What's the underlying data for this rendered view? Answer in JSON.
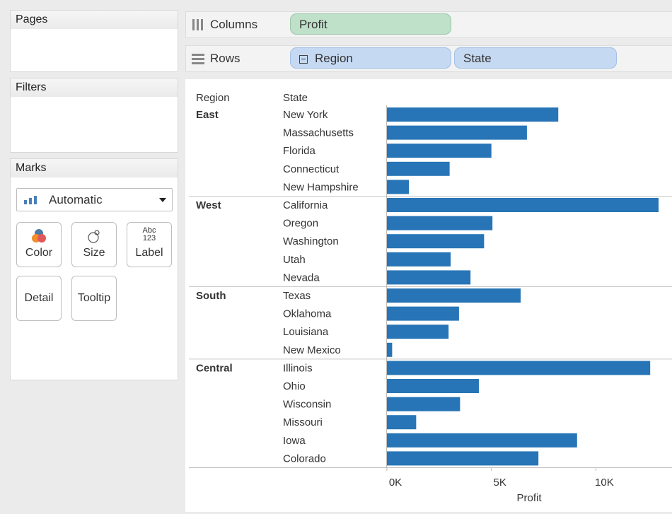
{
  "panels": {
    "pages": "Pages",
    "filters": "Filters",
    "marks": "Marks"
  },
  "marks_card": {
    "mark_type": "Automatic",
    "buttons": {
      "color": "Color",
      "size": "Size",
      "label": "Label",
      "label_icon_top": "Abc",
      "label_icon_bottom": "123",
      "detail": "Detail",
      "tooltip": "Tooltip"
    }
  },
  "shelves": {
    "columns": {
      "label": "Columns",
      "pills": [
        "Profit"
      ]
    },
    "rows": {
      "label": "Rows",
      "pills": [
        "Region",
        "State"
      ]
    }
  },
  "colors": {
    "bar": "#2775b6",
    "columns_pill": "#bfe0c9",
    "rows_pill": "#c6d9f2"
  },
  "chart_data": {
    "type": "bar",
    "orientation": "horizontal",
    "row_headers": [
      "Region",
      "State"
    ],
    "xlabel": "Profit",
    "xticks": [
      "0K",
      "5K",
      "10K"
    ],
    "xlim": [
      0,
      13500
    ],
    "groups": [
      {
        "region": "East",
        "states": [
          {
            "name": "New York",
            "value": 8200
          },
          {
            "name": "Massachusetts",
            "value": 6700
          },
          {
            "name": "Florida",
            "value": 5000
          },
          {
            "name": "Connecticut",
            "value": 3000
          },
          {
            "name": "New Hampshire",
            "value": 1050
          }
        ]
      },
      {
        "region": "West",
        "states": [
          {
            "name": "California",
            "value": 13000
          },
          {
            "name": "Oregon",
            "value": 5050
          },
          {
            "name": "Washington",
            "value": 4650
          },
          {
            "name": "Utah",
            "value": 3050
          },
          {
            "name": "Nevada",
            "value": 4000
          }
        ]
      },
      {
        "region": "South",
        "states": [
          {
            "name": "Texas",
            "value": 6400
          },
          {
            "name": "Oklahoma",
            "value": 3450
          },
          {
            "name": "Louisiana",
            "value": 2950
          },
          {
            "name": "New Mexico",
            "value": 250
          }
        ]
      },
      {
        "region": "Central",
        "states": [
          {
            "name": "Illinois",
            "value": 12600
          },
          {
            "name": "Ohio",
            "value": 4400
          },
          {
            "name": "Wisconsin",
            "value": 3500
          },
          {
            "name": "Missouri",
            "value": 1400
          },
          {
            "name": "Iowa",
            "value": 9100
          },
          {
            "name": "Colorado",
            "value": 7250
          }
        ]
      }
    ]
  }
}
